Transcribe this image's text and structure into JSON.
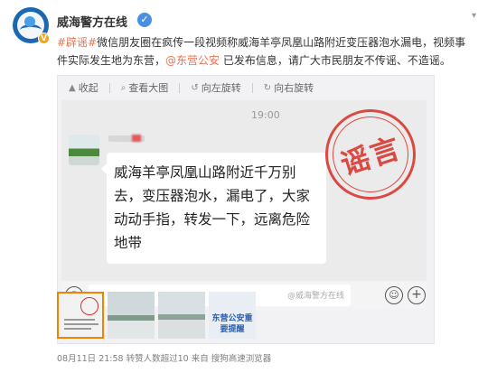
{
  "account": {
    "name": "威海警方在线",
    "avatar_icon": "police-badge-icon",
    "verified_icon": "verified-v-icon",
    "badge_text": "V"
  },
  "post": {
    "tag": "#辟谣#",
    "text_1": "微信朋友圈在疯传一段视频称威海羊亭凤凰山路附近变压器泡水漏电，视频事件实际发生地为东营，",
    "mention": "@东营公安",
    "text_2": " 已发布信息，请广大市民朋友不传谣、不造谣。"
  },
  "viewer": {
    "toolbar": {
      "collapse_label": "收起",
      "view_large_label": "查看大图",
      "rotate_left_label": "向左旋转",
      "rotate_right_label": "向右旋转"
    },
    "chat": {
      "time": "19:00",
      "message": "威海羊亭凤凰山路附近千万别去，变压器泡水，漏电了，大家动动手指，转发一下，远离危险地带",
      "stamp_text": "谣言",
      "watermark": "@威海警方在线"
    },
    "thumbnails": [
      {
        "name": "thumbnail-rumor-chat"
      },
      {
        "name": "thumbnail-scene-1"
      },
      {
        "name": "thumbnail-scene-2"
      },
      {
        "name": "thumbnail-notice",
        "label": "东营公安重要提醒"
      }
    ]
  },
  "footer": {
    "date": "08月11日 21:58",
    "reposts": "转赞人数超过10",
    "source": "来自 搜狗高速浏览器"
  },
  "colors": {
    "accent": "#eb7350",
    "stamp": "#d9342b",
    "brand_blue": "#1b67b1"
  }
}
